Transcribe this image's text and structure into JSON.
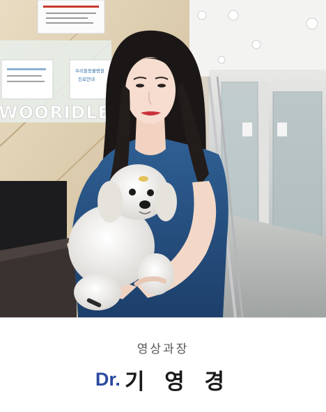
{
  "photo": {
    "subject": "veterinarian holding a white dog",
    "signage": {
      "clinic_sign": "WOORIDLE",
      "notice_lines": [
        "우리들동물병원",
        "진료안내"
      ]
    }
  },
  "caption": {
    "role": "영상과장",
    "prefix": "Dr.",
    "name": "기 영 경"
  },
  "colors": {
    "prefix_blue": "#2b4aa0",
    "name_text": "#1a1a1a",
    "role_text": "#555555",
    "background": "#ffffff"
  }
}
